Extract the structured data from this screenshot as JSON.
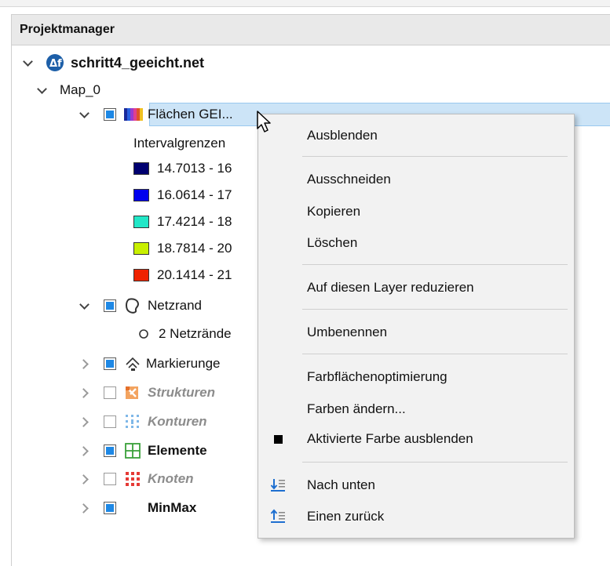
{
  "panel": {
    "title": "Projektmanager"
  },
  "tree": {
    "root": {
      "label": "schritt4_geeicht.net"
    },
    "map": {
      "label": "Map_0"
    },
    "layers": {
      "flaechen": {
        "label": "Flächen GEI..."
      },
      "intervalgrenzen": {
        "label": "Intervalgrenzen"
      },
      "legend": [
        {
          "label": "14.7013 - 16",
          "color": "#000070"
        },
        {
          "label": "16.0614 - 17",
          "color": "#0000ee"
        },
        {
          "label": "17.4214 - 18",
          "color": "#22e7c7"
        },
        {
          "label": "18.7814 - 20",
          "color": "#c8ef00"
        },
        {
          "label": "20.1414 - 21",
          "color": "#ef2200"
        }
      ],
      "netzrand": {
        "label": "Netzrand"
      },
      "netzraender": {
        "label": "2 Netzrände"
      },
      "markierungen": {
        "label": "Markierunge"
      },
      "strukturen": {
        "label": "Strukturen"
      },
      "konturen": {
        "label": "Konturen"
      },
      "elemente": {
        "label": "Elemente"
      },
      "knoten": {
        "label": "Knoten"
      },
      "minmax": {
        "label": "MinMax"
      }
    }
  },
  "context_menu": {
    "items": [
      {
        "label": "Ausblenden"
      },
      {
        "label": "Ausschneiden"
      },
      {
        "label": "Kopieren"
      },
      {
        "label": "Löschen"
      },
      {
        "label": "Auf diesen Layer reduzieren"
      },
      {
        "label": "Umbenennen"
      },
      {
        "label": "Farbflächenoptimierung"
      },
      {
        "label": "Farben ändern..."
      },
      {
        "label": "Aktivierte Farbe ausblenden"
      },
      {
        "label": "Nach unten"
      },
      {
        "label": "Einen zurück"
      }
    ]
  },
  "colors": {
    "accent": "#1e88e5",
    "selection": "#cce4f7"
  }
}
